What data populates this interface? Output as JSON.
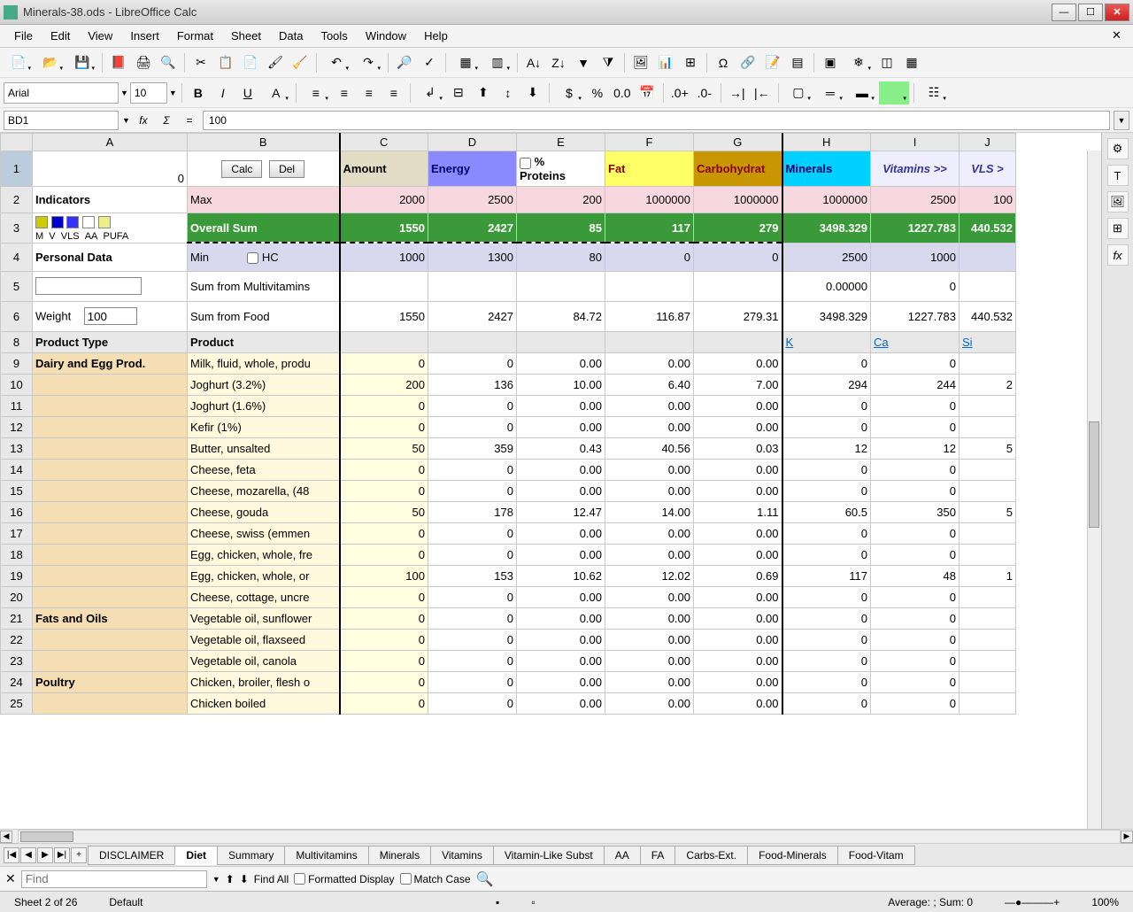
{
  "window": {
    "title": "Minerals-38.ods - LibreOffice Calc"
  },
  "menu": [
    "File",
    "Edit",
    "View",
    "Insert",
    "Format",
    "Sheet",
    "Data",
    "Tools",
    "Window",
    "Help"
  ],
  "toolbar2": {
    "font_name": "Arial",
    "font_size": "10"
  },
  "formula_bar": {
    "cell_ref": "BD1",
    "formula": "100"
  },
  "columns": [
    "A",
    "B",
    "C",
    "D",
    "E",
    "F",
    "G",
    "H",
    "I",
    "J"
  ],
  "row1": {
    "a_val": "0",
    "calc_btn": "Calc",
    "del_btn": "Del",
    "amount": "Amount",
    "energy": "Energy",
    "proteins": "Proteins",
    "proteins_pct": "%",
    "fat": "Fat",
    "carbs": "Carbohydrat",
    "minerals": "Minerals",
    "vitamins": "Vitamins >>",
    "vls": "VLS >"
  },
  "row2": {
    "a": "Indicators",
    "b": "Max",
    "c": "2000",
    "d": "2500",
    "e": "200",
    "f": "1000000",
    "g": "1000000",
    "h": "1000000",
    "i": "2500",
    "j": "100"
  },
  "row3": {
    "a_labels": [
      "M",
      "V",
      "VLS",
      "AA",
      "PUFA"
    ],
    "b": "Overall Sum",
    "c": "1550",
    "d": "2427",
    "e": "85",
    "f": "117",
    "g": "279",
    "h": "3498.329",
    "i": "1227.783",
    "j": "440.532"
  },
  "row4": {
    "a": "Personal Data",
    "b": "Min",
    "b_chk": "HC",
    "c": "1000",
    "d": "1300",
    "e": "80",
    "f": "0",
    "g": "0",
    "h": "2500",
    "i": "1000",
    "j": ""
  },
  "row5": {
    "b": "Sum from Multivitamins",
    "h": "0.00000",
    "i": "0"
  },
  "row6": {
    "a": "Weight",
    "a_val": "100",
    "b": "Sum from Food",
    "c": "1550",
    "d": "2427",
    "e": "84.72",
    "f": "116.87",
    "g": "279.31",
    "h": "3498.329",
    "i": "1227.783",
    "j": "440.532"
  },
  "row8": {
    "a": "Product Type",
    "b": "Product",
    "h": "K",
    "i": "Ca",
    "j": "Si"
  },
  "data_rows": [
    {
      "n": 9,
      "type": "Dairy and Egg Prod.",
      "prod": "Milk, fluid, whole, produ",
      "c": "0",
      "d": "0",
      "e": "0.00",
      "f": "0.00",
      "g": "0.00",
      "h": "0",
      "i": "0",
      "j": ""
    },
    {
      "n": 10,
      "type": "",
      "prod": "Joghurt (3.2%)",
      "c": "200",
      "d": "136",
      "e": "10.00",
      "f": "6.40",
      "g": "7.00",
      "h": "294",
      "i": "244",
      "j": "2"
    },
    {
      "n": 11,
      "type": "",
      "prod": "Joghurt (1.6%)",
      "c": "0",
      "d": "0",
      "e": "0.00",
      "f": "0.00",
      "g": "0.00",
      "h": "0",
      "i": "0",
      "j": ""
    },
    {
      "n": 12,
      "type": "",
      "prod": "Kefir (1%)",
      "c": "0",
      "d": "0",
      "e": "0.00",
      "f": "0.00",
      "g": "0.00",
      "h": "0",
      "i": "0",
      "j": ""
    },
    {
      "n": 13,
      "type": "",
      "prod": "Butter, unsalted",
      "c": "50",
      "d": "359",
      "e": "0.43",
      "f": "40.56",
      "g": "0.03",
      "h": "12",
      "i": "12",
      "j": "5"
    },
    {
      "n": 14,
      "type": "",
      "prod": "Cheese, feta",
      "c": "0",
      "d": "0",
      "e": "0.00",
      "f": "0.00",
      "g": "0.00",
      "h": "0",
      "i": "0",
      "j": ""
    },
    {
      "n": 15,
      "type": "",
      "prod": "Cheese, mozarella, (48",
      "c": "0",
      "d": "0",
      "e": "0.00",
      "f": "0.00",
      "g": "0.00",
      "h": "0",
      "i": "0",
      "j": ""
    },
    {
      "n": 16,
      "type": "",
      "prod": "Cheese, gouda",
      "c": "50",
      "d": "178",
      "e": "12.47",
      "f": "14.00",
      "g": "1.11",
      "h": "60.5",
      "i": "350",
      "j": "5"
    },
    {
      "n": 17,
      "type": "",
      "prod": "Cheese, swiss (emmen",
      "c": "0",
      "d": "0",
      "e": "0.00",
      "f": "0.00",
      "g": "0.00",
      "h": "0",
      "i": "0",
      "j": ""
    },
    {
      "n": 18,
      "type": "",
      "prod": "Egg, chicken, whole, fre",
      "c": "0",
      "d": "0",
      "e": "0.00",
      "f": "0.00",
      "g": "0.00",
      "h": "0",
      "i": "0",
      "j": ""
    },
    {
      "n": 19,
      "type": "",
      "prod": "Egg, chicken, whole, or",
      "c": "100",
      "d": "153",
      "e": "10.62",
      "f": "12.02",
      "g": "0.69",
      "h": "117",
      "i": "48",
      "j": "1"
    },
    {
      "n": 20,
      "type": "",
      "prod": "Cheese, cottage, uncre",
      "c": "0",
      "d": "0",
      "e": "0.00",
      "f": "0.00",
      "g": "0.00",
      "h": "0",
      "i": "0",
      "j": ""
    },
    {
      "n": 21,
      "type": "Fats and Oils",
      "prod": "Vegetable oil, sunflower",
      "c": "0",
      "d": "0",
      "e": "0.00",
      "f": "0.00",
      "g": "0.00",
      "h": "0",
      "i": "0",
      "j": ""
    },
    {
      "n": 22,
      "type": "",
      "prod": "Vegetable oil, flaxseed",
      "c": "0",
      "d": "0",
      "e": "0.00",
      "f": "0.00",
      "g": "0.00",
      "h": "0",
      "i": "0",
      "j": ""
    },
    {
      "n": 23,
      "type": "",
      "prod": "Vegetable oil, canola",
      "c": "0",
      "d": "0",
      "e": "0.00",
      "f": "0.00",
      "g": "0.00",
      "h": "0",
      "i": "0",
      "j": ""
    },
    {
      "n": 24,
      "type": "Poultry",
      "prod": "Chicken, broiler, flesh o",
      "c": "0",
      "d": "0",
      "e": "0.00",
      "f": "0.00",
      "g": "0.00",
      "h": "0",
      "i": "0",
      "j": ""
    },
    {
      "n": 25,
      "type": "",
      "prod": "Chicken boiled",
      "c": "0",
      "d": "0",
      "e": "0.00",
      "f": "0.00",
      "g": "0.00",
      "h": "0",
      "i": "0",
      "j": ""
    }
  ],
  "sheet_tabs": [
    "DISCLAIMER",
    "Diet",
    "Summary",
    "Multivitamins",
    "Minerals",
    "Vitamins",
    "Vitamin-Like Subst",
    "AA",
    "FA",
    "Carbs-Ext.",
    "Food-Minerals",
    "Food-Vitam"
  ],
  "active_tab": "Diet",
  "find": {
    "placeholder": "Find",
    "findall": "Find All",
    "formatted": "Formatted Display",
    "matchcase": "Match Case"
  },
  "status": {
    "sheet": "Sheet 2 of 26",
    "style": "Default",
    "summary": "Average: ; Sum: 0",
    "zoom": "100%"
  }
}
